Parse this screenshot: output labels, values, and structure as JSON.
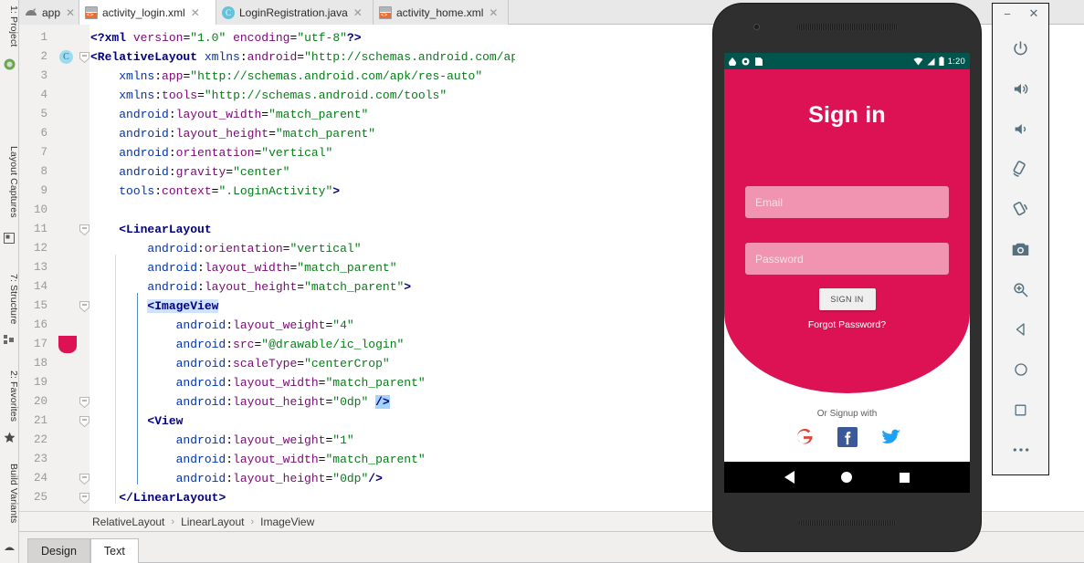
{
  "ide": {
    "left_tools": [
      {
        "label": "1: Project",
        "icon": "project-icon"
      },
      {
        "label": "Layout Captures",
        "icon": "layout-captures-icon"
      },
      {
        "label": "7: Structure",
        "icon": "structure-icon"
      },
      {
        "label": "2: Favorites",
        "icon": "star-icon"
      },
      {
        "label": "Build Variants",
        "icon": "build-variants-icon"
      }
    ],
    "tabs": [
      {
        "label": "app",
        "icon": "module-icon",
        "active": false,
        "closable": true
      },
      {
        "label": "activity_login.xml",
        "icon": "xml-layout-icon",
        "active": true,
        "closable": true
      },
      {
        "label": "LoginRegistration.java",
        "icon": "java-class-icon",
        "active": false,
        "closable": true
      },
      {
        "label": "activity_home.xml",
        "icon": "xml-layout-icon",
        "active": false,
        "closable": true
      }
    ],
    "breadcrumb": [
      "RelativeLayout",
      "LinearLayout",
      "ImageView"
    ],
    "breadcrumb_separator": "›",
    "bottom_tabs": [
      {
        "label": "Design",
        "active": false
      },
      {
        "label": "Text",
        "active": true
      }
    ],
    "editor": {
      "highlighted_line": 15,
      "color_swatch_line": 17,
      "color_swatch_hex": "#dd1255",
      "class_marker_line": 2,
      "class_marker_letter": "C",
      "lines": [
        {
          "n": 1,
          "text": "<?xml version=\"1.0\" encoding=\"utf-8\"?>"
        },
        {
          "n": 2,
          "text": "<RelativeLayout xmlns:android=\"http://schemas.android.com/apk/res/android\""
        },
        {
          "n": 3,
          "text": "    xmlns:app=\"http://schemas.android.com/apk/res-auto\""
        },
        {
          "n": 4,
          "text": "    xmlns:tools=\"http://schemas.android.com/tools\""
        },
        {
          "n": 5,
          "text": "    android:layout_width=\"match_parent\""
        },
        {
          "n": 6,
          "text": "    android:layout_height=\"match_parent\""
        },
        {
          "n": 7,
          "text": "    android:orientation=\"vertical\""
        },
        {
          "n": 8,
          "text": "    android:gravity=\"center\""
        },
        {
          "n": 9,
          "text": "    tools:context=\".LoginActivity\">"
        },
        {
          "n": 10,
          "text": ""
        },
        {
          "n": 11,
          "text": "    <LinearLayout"
        },
        {
          "n": 12,
          "text": "        android:orientation=\"vertical\""
        },
        {
          "n": 13,
          "text": "        android:layout_width=\"match_parent\""
        },
        {
          "n": 14,
          "text": "        android:layout_height=\"match_parent\">"
        },
        {
          "n": 15,
          "text": "        <ImageView"
        },
        {
          "n": 16,
          "text": "            android:layout_weight=\"4\""
        },
        {
          "n": 17,
          "text": "            android:src=\"@drawable/ic_login\""
        },
        {
          "n": 18,
          "text": "            android:scaleType=\"centerCrop\""
        },
        {
          "n": 19,
          "text": "            android:layout_width=\"match_parent\""
        },
        {
          "n": 20,
          "text": "            android:layout_height=\"0dp\" />"
        },
        {
          "n": 21,
          "text": "        <View"
        },
        {
          "n": 22,
          "text": "            android:layout_weight=\"1\""
        },
        {
          "n": 23,
          "text": "            android:layout_width=\"match_parent\""
        },
        {
          "n": 24,
          "text": "            android:layout_height=\"0dp\"/>"
        },
        {
          "n": 25,
          "text": "    </LinearLayout>"
        }
      ]
    }
  },
  "emulator": {
    "window_buttons": [
      {
        "label": "−",
        "name": "minimize-button"
      },
      {
        "label": "✕",
        "name": "close-button"
      }
    ],
    "tools": [
      "power-icon",
      "volume-up-icon",
      "volume-down-icon",
      "rotate-left-icon",
      "rotate-right-icon",
      "camera-icon",
      "zoom-icon",
      "back-icon",
      "home-icon",
      "overview-icon",
      "more-icon"
    ],
    "screen": {
      "statusbar": {
        "time": "1:20"
      },
      "title": "Sign in",
      "email_placeholder": "Email",
      "password_placeholder": "Password",
      "signin_label": "SIGN IN",
      "forgot_label": "Forgot Password?",
      "signup_label": "Or Signup with",
      "socials": [
        "google-icon",
        "facebook-icon",
        "twitter-icon"
      ],
      "nav": [
        "back-nav-icon",
        "home-nav-icon",
        "overview-nav-icon"
      ],
      "accent_color": "#dd1255",
      "statusbar_color": "#00564d"
    }
  }
}
